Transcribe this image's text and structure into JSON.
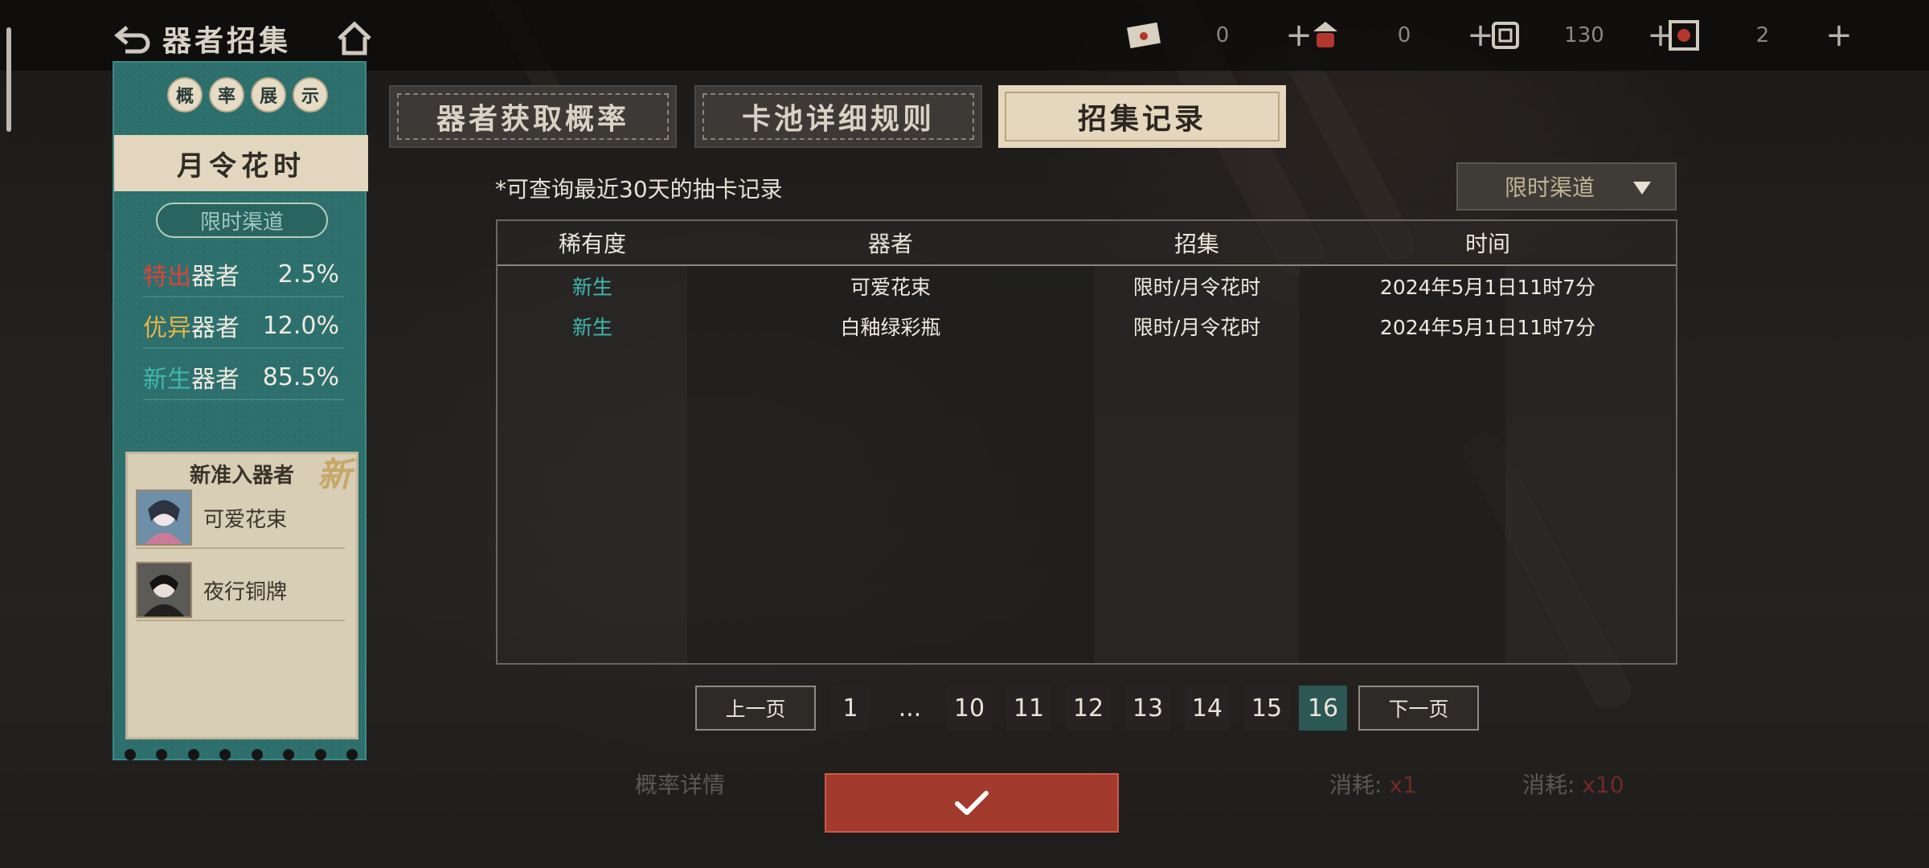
{
  "topbar": {
    "title": "器者招集",
    "currencies": [
      {
        "icon": "letter-ticket-icon",
        "value": "0",
        "plus": "+"
      },
      {
        "icon": "lantern-icon",
        "value": "0",
        "plus": "+"
      },
      {
        "icon": "scroll-icon",
        "value": "130",
        "plus": "+"
      },
      {
        "icon": "seal-ticket-icon",
        "value": "2",
        "plus": "+"
      }
    ]
  },
  "left_panel": {
    "header_chars": [
      "概",
      "率",
      "展",
      "示"
    ],
    "pool_name": "月令花时",
    "channel": "限时渠道",
    "rates": [
      {
        "tier": "特出",
        "suffix": "器者",
        "pct": "2.5%",
        "color": "#e0413a"
      },
      {
        "tier": "优异",
        "suffix": "器者",
        "pct": "12.0%",
        "color": "#e2b54a"
      },
      {
        "tier": "新生",
        "suffix": "器者",
        "pct": "85.5%",
        "color": "#43b6ae"
      }
    ],
    "new_title": "新准入器者",
    "new_badge": "新",
    "new_items": [
      {
        "name": "可爱花束"
      },
      {
        "name": "夜行铜牌"
      }
    ]
  },
  "tabs": [
    {
      "label": "器者获取概率",
      "active": false
    },
    {
      "label": "卡池详细规则",
      "active": false
    },
    {
      "label": "招集记录",
      "active": true
    }
  ],
  "records": {
    "hint": "*可查询最近30天的抽卡记录",
    "filter": "限时渠道",
    "columns": [
      "稀有度",
      "器者",
      "招集",
      "时间"
    ],
    "rows": [
      {
        "rarity": "新生",
        "item": "可爱花束",
        "pool": "限时/月令花时",
        "time": "2024年5月1日11时7分"
      },
      {
        "rarity": "新生",
        "item": "白釉绿彩瓶",
        "pool": "限时/月令花时",
        "time": "2024年5月1日11时7分"
      }
    ]
  },
  "pagination": {
    "prev": "上一页",
    "next": "下一页",
    "pages": [
      "1",
      "...",
      "10",
      "11",
      "12",
      "13",
      "14",
      "15",
      "16"
    ],
    "current": "16"
  },
  "background_text": {
    "prob_detail": "概率详情",
    "cost1": "消耗:",
    "cost1_qty": "x1",
    "cost2": "消耗:",
    "cost2_qty": "x10"
  }
}
